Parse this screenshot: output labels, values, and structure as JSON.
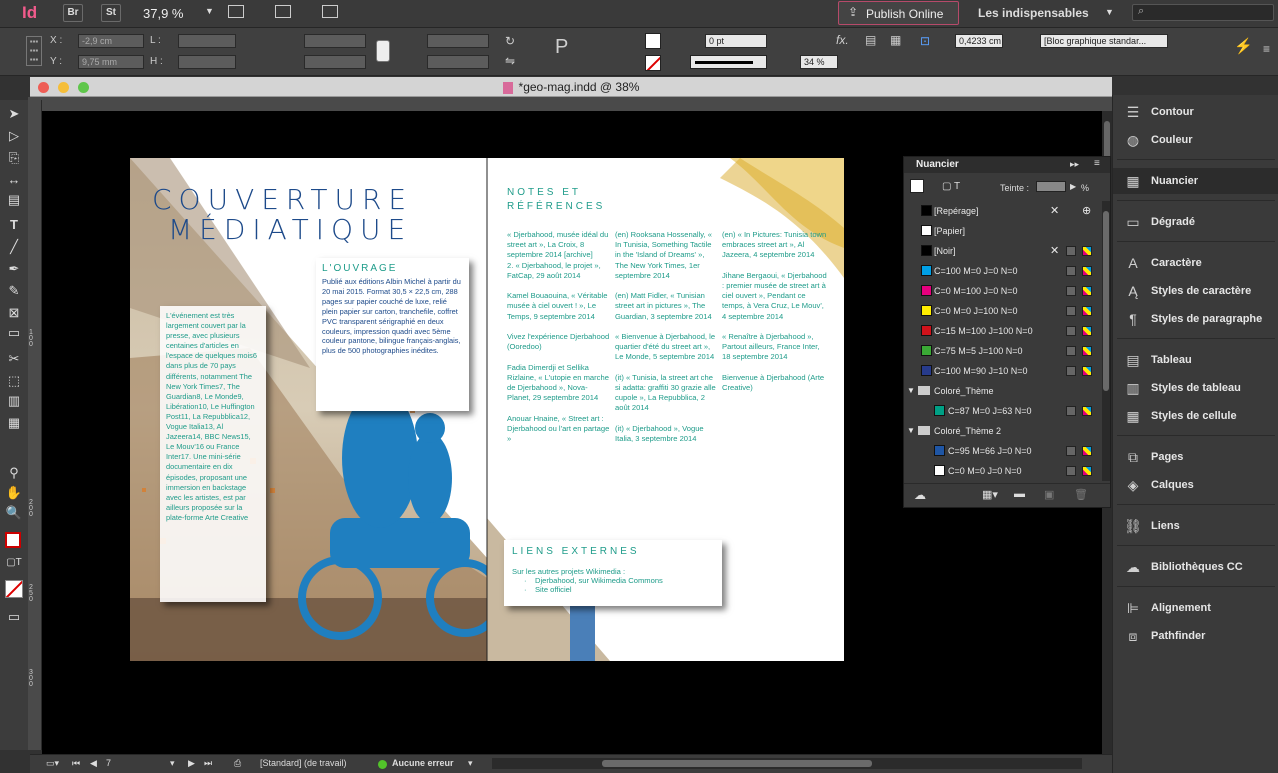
{
  "app": {
    "logo": "Id",
    "bridge": "Br",
    "stock": "St",
    "zoom": "37,9 %",
    "publish": "Publish Online",
    "workspace": "Les indispensables"
  },
  "control": {
    "x_label": "X :",
    "x_value": "-2,9 cm",
    "y_label": "Y :",
    "y_value": "9,75 mm",
    "w_label": "L :",
    "h_label": "H :",
    "stroke_weight": "0 pt",
    "opacity": "34 %",
    "gap": "0,4233 cm",
    "object_style": "[Bloc graphique standar..."
  },
  "document": {
    "title": "*geo-mag.indd @ 38%"
  },
  "status": {
    "page": "7",
    "profile": "[Standard] (de travail)",
    "errors": "Aucune erreur"
  },
  "ruler_v_labels": [
    "1 0 0",
    "2 0 0",
    "2 5 0",
    "3 0 0"
  ],
  "spread": {
    "title_line1": "COUVERTURE",
    "title_line2": "MÉDIATIQUE",
    "louvrage_heading": "L'OUVRAGE",
    "louvrage_text": "Publié aux éditions Albin Michel à partir du 20 mai 2015. Format 30,5 × 22,5 cm, 288 pages sur papier couché de luxe, relié plein papier sur carton, tranchefile, coffret PVC transparent sérigraphié en deux couleurs, impression quadri avec 5ème couleur pantone, bilingue français-anglais, plus de 500 photographies inédites.",
    "left_box_text": "L'événement est très largement couvert par la presse, avec plusieurs centaines d'articles en l'espace de quelques mois6 dans plus de 70 pays différents, notamment The New York Times7, The Guardian8, Le Monde9, Libération10, Le Huffington Post11, La Repubblica12, Vogue Italia13, Al Jazeera14, BBC News15, Le Mouv'16 ou France Inter17. Une mini-série documentaire en dix épisodes, proposant une immersion en backstage avec les artistes, est par ailleurs proposée sur la plate-forme Arte Creative",
    "notes_heading": "NOTES ET RÉFÉRENCES",
    "notes_col1": "« Djerbahood, musée idéal du street art », La Croix, 8 septembre 2014 [archive]\n2.   « Djerbahood, le projet », FatCap, 29 août 2014\n\n Kamel Bouaouina, « Véritable musée à ciel ouvert ! », Le Temps, 9 septembre 2014\n\n Vivez l'expérience Djerbahood (Ooredoo)\n\n Fadia Dimerdji et Sellika Rizlaine, « L'utopie en marche de Djerbahood », Nova-Planet, 29 septembre 2014\n\n Anouar Hnaine, « Street art : Djerbahood ou l'art en partage »",
    "notes_col2": "(en) Rooksana Hossenally, « In Tunisia, Something Tactile in the 'Island of Dreams' », The New York Times, 1er septembre 2014\n\n (en) Matt Fidler, « Tunisian street art in pictures », The Guardian, 3 septembre 2014\n\n « Bienvenue à Djerbahood, le quartier d'été du street art », Le Monde, 5 septembre 2014\n\n (it) « Tunisia, la street art che si adatta: graffiti 30 grazie alle cupole », La Repubblica, 2 août 2014\n\n (it) « Djerbahood », Vogue Italia, 3 septembre 2014",
    "notes_col3": "(en) « In Pictures: Tunisia town embraces street art », Al Jazeera, 4 septembre 2014\n\n Jihane Bergaoui, « Djerbahood : premier musée de street art à ciel ouvert », Pendant ce temps, à Vera Cruz, Le Mouv', 4 septembre 2014\n\n « Renaître à Djerbahood », Partout ailleurs, France Inter, 18 septembre 2014\n\n Bienvenue à Djerbahood (Arte Creative)",
    "liens_heading": "LIENS EXTERNES",
    "liens_intro": "Sur les autres projets Wikimedia :",
    "liens_items": [
      "Djerbahood, sur Wikimedia Commons",
      "Site officiel"
    ]
  },
  "swatches_panel": {
    "title": "Nuancier",
    "tint_label": "Teinte :",
    "tint_unit": "%",
    "swatches": [
      {
        "name": "[Repérage]",
        "color": "#000000"
      },
      {
        "name": "[Papier]",
        "color": "#ffffff"
      },
      {
        "name": "[Noir]",
        "color": "#000000"
      },
      {
        "name": "C=100 M=0 J=0 N=0",
        "color": "#00a0e6"
      },
      {
        "name": "C=0 M=100 J=0 N=0",
        "color": "#e6007e"
      },
      {
        "name": "C=0 M=0 J=100 N=0",
        "color": "#ffed00"
      },
      {
        "name": "C=15 M=100 J=100 N=0",
        "color": "#d0121b"
      },
      {
        "name": "C=75 M=5 J=100 N=0",
        "color": "#3aa935"
      },
      {
        "name": "C=100 M=90 J=10 N=0",
        "color": "#273b8c"
      },
      {
        "name": "Coloré_Thème",
        "color": ""
      },
      {
        "name": "C=87 M=0 J=63 N=0",
        "color": "#00a085"
      },
      {
        "name": "Coloré_Thème 2",
        "color": ""
      },
      {
        "name": "C=95 M=66 J=0 N=0",
        "color": "#1f56a5"
      },
      {
        "name": "C=0 M=0 J=0 N=0",
        "color": "#ffffff"
      }
    ]
  },
  "right_panel": [
    {
      "label": "Contour",
      "icon": "stroke-icon"
    },
    {
      "label": "Couleur",
      "icon": "palette-icon"
    },
    {
      "label": "Nuancier",
      "icon": "swatches-icon"
    },
    {
      "label": "Dégradé",
      "icon": "gradient-icon"
    },
    {
      "label": "Caractère",
      "icon": "character-icon"
    },
    {
      "label": "Styles de caractère",
      "icon": "character-styles-icon"
    },
    {
      "label": "Styles de paragraphe",
      "icon": "paragraph-styles-icon"
    },
    {
      "label": "Tableau",
      "icon": "table-icon"
    },
    {
      "label": "Styles de tableau",
      "icon": "table-styles-icon"
    },
    {
      "label": "Styles de cellule",
      "icon": "cell-styles-icon"
    },
    {
      "label": "Pages",
      "icon": "pages-icon"
    },
    {
      "label": "Calques",
      "icon": "layers-icon"
    },
    {
      "label": "Liens",
      "icon": "links-icon"
    },
    {
      "label": "Bibliothèques CC",
      "icon": "cc-libraries-icon"
    },
    {
      "label": "Alignement",
      "icon": "align-icon"
    },
    {
      "label": "Pathfinder",
      "icon": "pathfinder-icon"
    }
  ]
}
